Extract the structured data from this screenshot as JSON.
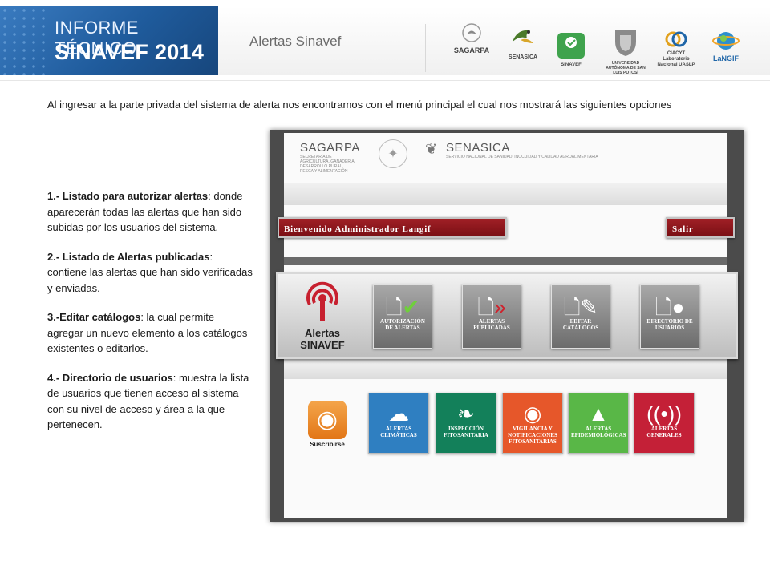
{
  "header": {
    "banner_line1": "INFORME TÉCNICO",
    "banner_line2": "SINAVEF 2014",
    "title": "Alertas Sinavef",
    "logos": [
      {
        "name": "SAGARPA",
        "icon": "eagle-seal-icon",
        "caption": "SAGARPA"
      },
      {
        "name": "SENASICA",
        "icon": "senasica-bird-icon",
        "caption": "SENASICA"
      },
      {
        "name": "SINAVEF",
        "icon": "sinavef-logo-icon",
        "caption": "SINAVEF"
      },
      {
        "name": "UASLP",
        "icon": "university-shield-icon",
        "caption": "UNIVERSIDAD AUTÓNOMA DE SAN LUIS POTOSÍ"
      },
      {
        "name": "CIACYT",
        "icon": "ciacyt-logo-icon",
        "caption": "CIACYT Laboratorio Nacional UASLP"
      },
      {
        "name": "LaNGIF",
        "icon": "globe-logo-icon",
        "caption": "LaNGIF"
      }
    ]
  },
  "intro": "Al ingresar a la parte privada del sistema de alerta nos encontramos con el menú principal el cual nos mostrará las siguientes opciones",
  "items": [
    {
      "bold": "1.- Listado para autorizar alertas",
      "text": ": donde aparecerán todas las alertas que han sido subidas por los usuarios del sistema."
    },
    {
      "bold": "2.- Listado de Alertas publicadas",
      "text": ": contiene las alertas que han sido verificadas y enviadas."
    },
    {
      "bold": "3.-Editar catálogos",
      "text": ": la cual permite agregar un nuevo elemento a los catálogos existentes o editarlos."
    },
    {
      "bold": "4.- Directorio de usuarios",
      "text": ": muestra la lista de usuarios que tienen acceso al sistema con su nivel de acceso y área a la que pertenecen."
    }
  ],
  "screenshot": {
    "sagarpa": "SAGARPA",
    "sagarpa_sub": "SECRETARÍA DE AGRICULTURA, GANADERÍA, DESARROLLO RURAL, PESCA Y ALIMENTACIÓN",
    "senasica": "SENASICA",
    "senasica_sub": "SERVICIO NACIONAL DE SANIDAD, INOCUIDAD Y CALIDAD AGROALIMENTARIA",
    "welcome": "Bienvenido Administrador Langif",
    "logout": "Salir",
    "alert_logo_line1": "Alertas",
    "alert_logo_line2": "SINAVEF",
    "admin_tiles": [
      {
        "label": "Autorización de alertas",
        "icon": "document-check-icon"
      },
      {
        "label": "Alertas Publicadas",
        "icon": "document-forward-icon"
      },
      {
        "label": "Editar Catálogos",
        "icon": "document-edit-icon"
      },
      {
        "label": "Directorio de usuarios",
        "icon": "document-users-icon"
      }
    ],
    "subscribe": "Suscribirse",
    "category_tiles": [
      {
        "label": "Alertas Climáticas",
        "icon": "weather-cloud-icon",
        "color": "#2f7fc1"
      },
      {
        "label": "Inspección Fitosanitaria",
        "icon": "leaf-icon",
        "color": "#13805a"
      },
      {
        "label": "Vigilancia y Notificaciones Fitosanitarias",
        "icon": "eye-icon",
        "color": "#e6572a"
      },
      {
        "label": "Alertas Epidemiológicas",
        "icon": "warning-cross-icon",
        "color": "#59b747"
      },
      {
        "label": "Alertas Generales",
        "icon": "broadcast-icon",
        "color": "#c42037"
      }
    ]
  }
}
